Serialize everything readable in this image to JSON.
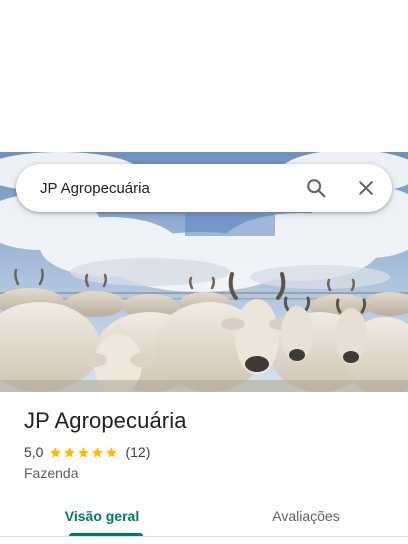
{
  "search": {
    "query": "JP Agropecuária",
    "search_icon": "search-icon",
    "close_icon": "close-icon"
  },
  "hero": {
    "image": "cattle-photo"
  },
  "place": {
    "title": "JP Agropecuária",
    "rating": "5,0",
    "stars": 5,
    "review_count": "(12)",
    "category": "Fazenda"
  },
  "tabs": [
    {
      "label": "Visão geral",
      "active": true
    },
    {
      "label": "Avaliações",
      "active": false
    }
  ],
  "colors": {
    "accent": "#00796b",
    "star": "#fbbc04",
    "text_primary": "#202124",
    "text_secondary": "#5f6368"
  }
}
